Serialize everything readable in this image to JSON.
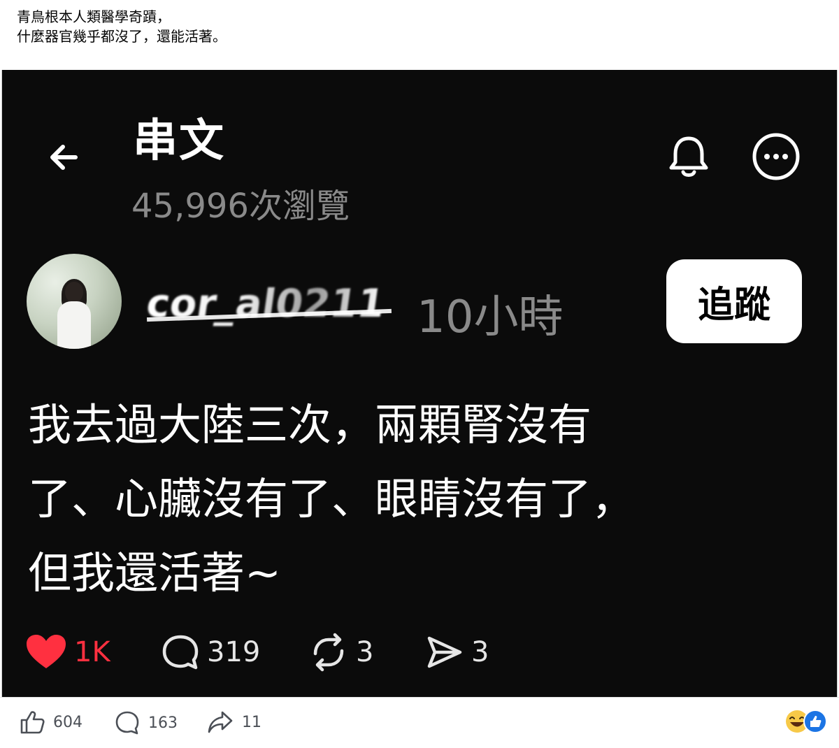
{
  "caption": {
    "line1": "青鳥根本人類醫學奇蹟，",
    "line2": "什麼器官幾乎都沒了，還能活著。"
  },
  "threads": {
    "title": "串文",
    "views": "45,996次瀏覽",
    "username": "cor_al0211",
    "time": "10小時",
    "follow_label": "追蹤",
    "body_lines": [
      "我去過大陸三次，兩顆腎沒有",
      "了、心臟沒有了、眼睛沒有了，",
      "但我還活著~"
    ],
    "stats": {
      "likes": "1K",
      "comments": "319",
      "reposts": "3",
      "shares": "3"
    },
    "like_color": "#ff3040"
  },
  "facebook": {
    "likes": "604",
    "comments": "163",
    "shares": "11",
    "reaction_icons": [
      "laugh-emoji-icon",
      "like-blue-icon"
    ]
  }
}
